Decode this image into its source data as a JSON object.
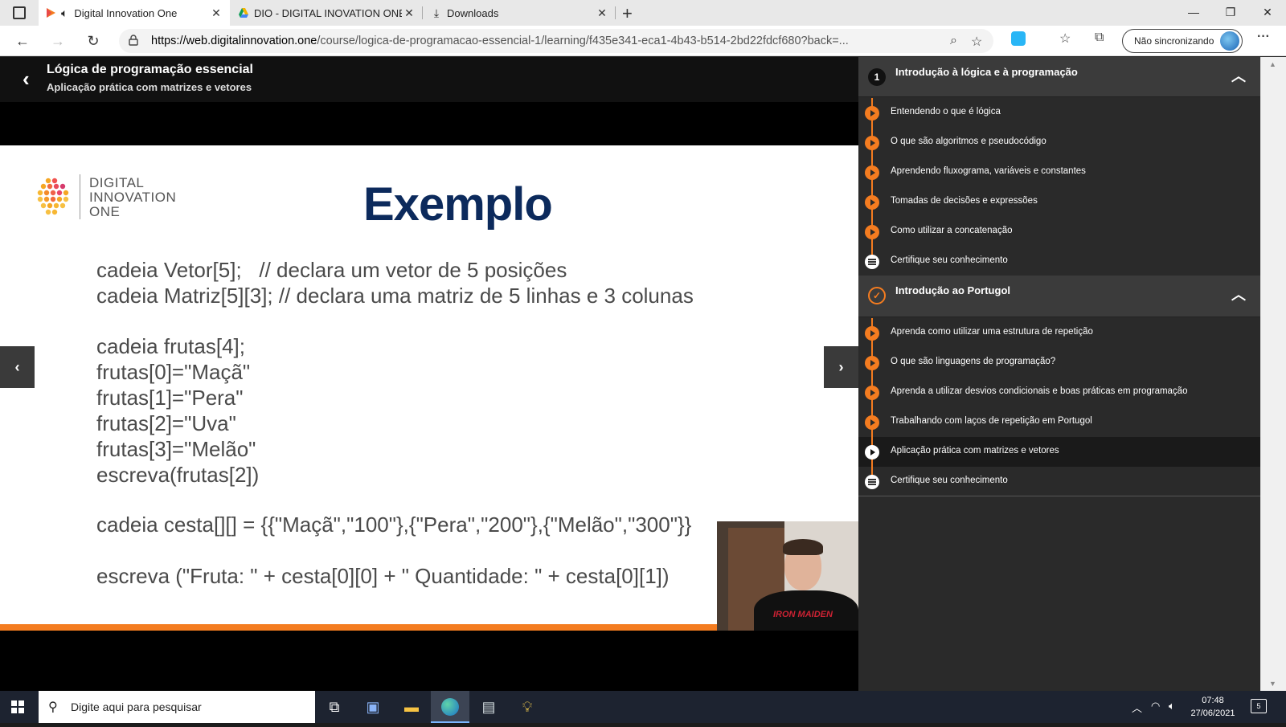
{
  "browser": {
    "tabs": [
      {
        "title": "Digital Innovation One",
        "active": true
      },
      {
        "title": "DIO - DIGITAL INOVATION ONE",
        "active": false
      },
      {
        "title": "Downloads",
        "active": false
      }
    ],
    "url_host": "https://web.digitalinnovation.one",
    "url_path": "/course/logica-de-programacao-essencial-1/learning/f435e341-eca1-4b43-b514-2bd22fdcf680?back=...",
    "sync_label": "Não sincronizando"
  },
  "course": {
    "title": "Lógica de programação essencial",
    "subtitle": "Aplicação prática com matrizes e vetores"
  },
  "slide": {
    "logo_line1": "DIGITAL",
    "logo_line2": "INNOVATION",
    "logo_line3": "ONE",
    "title": "Exemplo",
    "code_lines": [
      "cadeia Vetor[5];   // declara um vetor de 5 posições",
      "cadeia Matriz[5][3]; // declara uma matriz de 5 linhas e 3 colunas",
      "cadeia frutas[4];",
      "frutas[0]=\"Maçã\"",
      "frutas[1]=\"Pera\"",
      "frutas[2]=\"Uva\"",
      "frutas[3]=\"Melão\"",
      "escreva(frutas[2])",
      "cadeia cesta[][] = {{\"Maçã\",\"100\"},{\"Pera\",\"200\"},{\"Melão\",\"300\"}}",
      "escreva (\"Fruta: \" + cesta[0][0] + \" Quantidade: \" + cesta[0][1])"
    ],
    "webcam_shirt_text": "IRON MAIDEN"
  },
  "sidebar": {
    "modules": [
      {
        "number": "1",
        "title": "Introdução à lógica e à programação",
        "lessons": [
          {
            "label": "Entendendo o que é lógica",
            "kind": "video"
          },
          {
            "label": "O que são algoritmos e pseudocódigo",
            "kind": "video"
          },
          {
            "label": "Aprendendo fluxograma, variáveis e constantes",
            "kind": "video"
          },
          {
            "label": "Tomadas de decisões e expressões",
            "kind": "video"
          },
          {
            "label": "Como utilizar a concatenação",
            "kind": "video"
          },
          {
            "label": "Certifique seu conhecimento",
            "kind": "quiz"
          }
        ]
      },
      {
        "number": "",
        "title": "Introdução ao Portugol",
        "lessons": [
          {
            "label": "Aprenda como utilizar uma estrutura de repetição",
            "kind": "video"
          },
          {
            "label": "O que são linguagens de programação?",
            "kind": "video"
          },
          {
            "label": "Aprenda a utilizar desvios condicionais e boas práticas em programação",
            "kind": "video"
          },
          {
            "label": "Trabalhando com laços de repetição em Portugol",
            "kind": "video"
          },
          {
            "label": "Aplicação prática com matrizes e vetores",
            "kind": "video",
            "current": true
          },
          {
            "label": "Certifique seu conhecimento",
            "kind": "quiz"
          }
        ]
      }
    ]
  },
  "taskbar": {
    "search_placeholder": "Digite aqui para pesquisar",
    "time": "07:48",
    "date": "27/06/2021",
    "notifications": "5"
  },
  "colors": {
    "accent": "#f47c20",
    "slide_title": "#0c2a5c",
    "sidebar_bg": "#2a2a2a"
  }
}
